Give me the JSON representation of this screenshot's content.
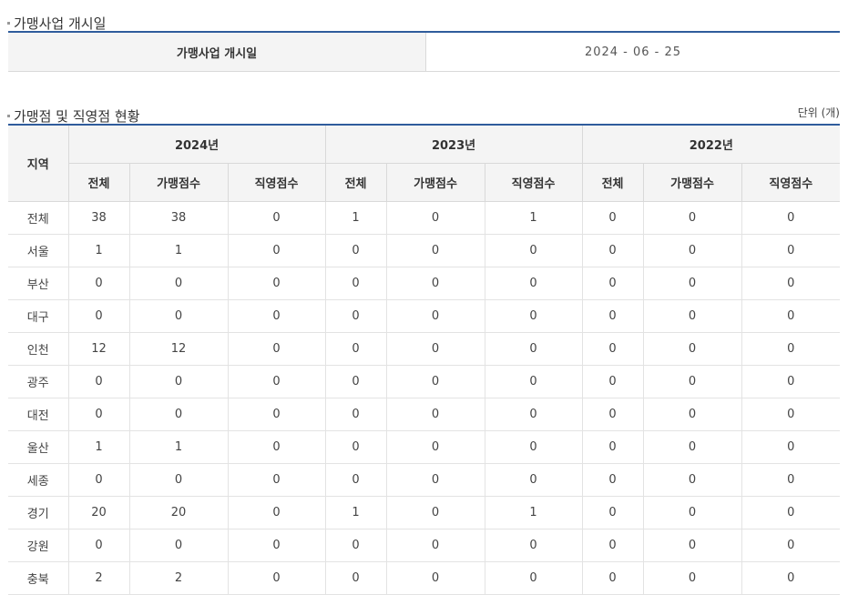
{
  "section1": {
    "title": "가맹사업 개시일"
  },
  "open_date": {
    "label": "가맹사업 개시일",
    "value": "2024 - 06 - 25"
  },
  "section2": {
    "title": "가맹점 및 직영점 현황",
    "unit": "단위 (개)"
  },
  "table": {
    "region_header": "지역",
    "years": [
      "2024년",
      "2023년",
      "2022년"
    ],
    "sub_headers": [
      "전체",
      "가맹점수",
      "직영점수"
    ],
    "rows": [
      {
        "region": "전체",
        "values": [
          "38",
          "38",
          "0",
          "1",
          "0",
          "1",
          "0",
          "0",
          "0"
        ]
      },
      {
        "region": "서울",
        "values": [
          "1",
          "1",
          "0",
          "0",
          "0",
          "0",
          "0",
          "0",
          "0"
        ]
      },
      {
        "region": "부산",
        "values": [
          "0",
          "0",
          "0",
          "0",
          "0",
          "0",
          "0",
          "0",
          "0"
        ]
      },
      {
        "region": "대구",
        "values": [
          "0",
          "0",
          "0",
          "0",
          "0",
          "0",
          "0",
          "0",
          "0"
        ]
      },
      {
        "region": "인천",
        "values": [
          "12",
          "12",
          "0",
          "0",
          "0",
          "0",
          "0",
          "0",
          "0"
        ]
      },
      {
        "region": "광주",
        "values": [
          "0",
          "0",
          "0",
          "0",
          "0",
          "0",
          "0",
          "0",
          "0"
        ]
      },
      {
        "region": "대전",
        "values": [
          "0",
          "0",
          "0",
          "0",
          "0",
          "0",
          "0",
          "0",
          "0"
        ]
      },
      {
        "region": "울산",
        "values": [
          "1",
          "1",
          "0",
          "0",
          "0",
          "0",
          "0",
          "0",
          "0"
        ]
      },
      {
        "region": "세종",
        "values": [
          "0",
          "0",
          "0",
          "0",
          "0",
          "0",
          "0",
          "0",
          "0"
        ]
      },
      {
        "region": "경기",
        "values": [
          "20",
          "20",
          "0",
          "1",
          "0",
          "1",
          "0",
          "0",
          "0"
        ]
      },
      {
        "region": "강원",
        "values": [
          "0",
          "0",
          "0",
          "0",
          "0",
          "0",
          "0",
          "0",
          "0"
        ]
      },
      {
        "region": "충북",
        "values": [
          "2",
          "2",
          "0",
          "0",
          "0",
          "0",
          "0",
          "0",
          "0"
        ]
      }
    ]
  },
  "colors": {
    "accent_border": "#2f5c9c",
    "header_bg": "#f4f4f4"
  }
}
